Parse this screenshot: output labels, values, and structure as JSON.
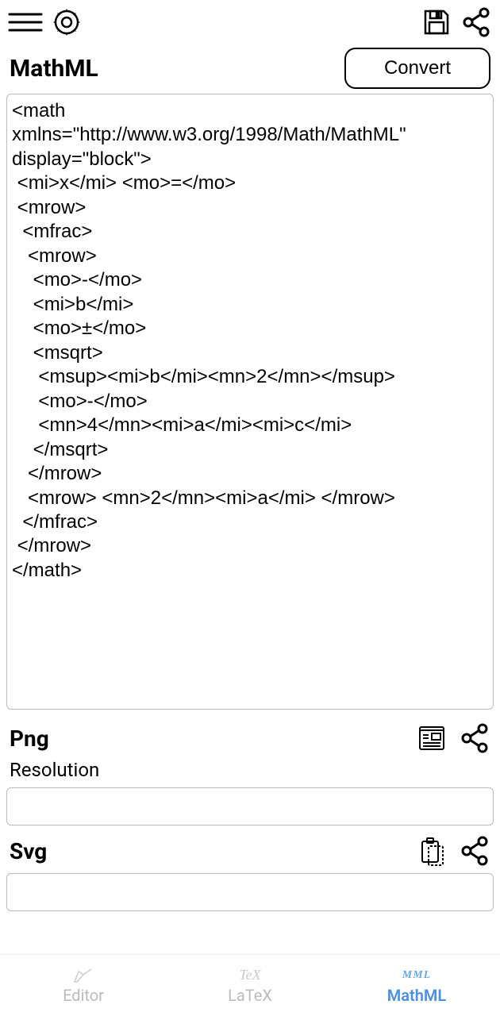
{
  "sections": {
    "mathml": {
      "title": "MathML",
      "convert_label": "Convert",
      "code": "<math\nxmlns=\"http://www.w3.org/1998/Math/MathML\"\ndisplay=\"block\">\n <mi>x</mi> <mo>=</mo>\n <mrow>\n  <mfrac>\n   <mrow>\n    <mo>-</mo>\n    <mi>b</mi>\n    <mo>±</mo>\n    <msqrt>\n     <msup><mi>b</mi><mn>2</mn></msup>\n     <mo>-</mo>\n     <mn>4</mn><mi>a</mi><mi>c</mi>\n    </msqrt>\n   </mrow>\n   <mrow> <mn>2</mn><mi>a</mi> </mrow>\n  </mfrac>\n </mrow>\n</math>"
    },
    "png": {
      "title": "Png",
      "resolution_label": "Resolution",
      "resolution_value": ""
    },
    "svg": {
      "title": "Svg",
      "value": ""
    }
  },
  "tabs": {
    "editor": {
      "label": "Editor"
    },
    "latex": {
      "label": "LaTeX",
      "icon_text": "TeX"
    },
    "mathml": {
      "label": "MathML",
      "icon_text": "MML"
    }
  }
}
